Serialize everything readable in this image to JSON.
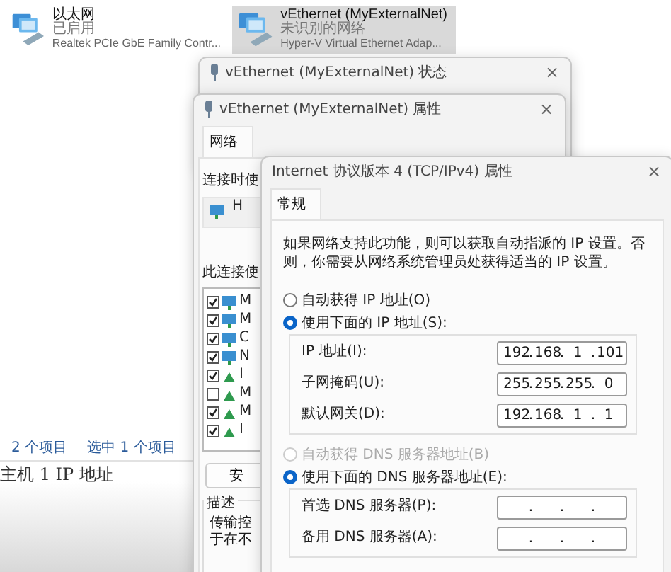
{
  "explorer": {
    "items": [
      {
        "name": "以太网",
        "status": "已启用",
        "device": "Realtek PCIe GbE Family Contr...",
        "selected": false
      },
      {
        "name": "vEthernet (MyExternalNet)",
        "status": "未识别的网络",
        "device": "Hyper-V Virtual Ethernet Adap...",
        "selected": true
      }
    ],
    "status_bar": [
      "2 个项目",
      "选中 1 个项目"
    ]
  },
  "page_heading": "主机 1 IP 地址",
  "status_window": {
    "title": "vEthernet (MyExternalNet) 状态",
    "close": "×"
  },
  "properties_window": {
    "title": "vEthernet (MyExternalNet) 属性",
    "close": "×",
    "tabs": [
      {
        "label": "网络",
        "selected": true
      }
    ],
    "connect_label": "连接时使",
    "adapter": "H",
    "items_label": "此连接使",
    "items": [
      {
        "kind": "client",
        "checked": true,
        "label": "M"
      },
      {
        "kind": "client",
        "checked": true,
        "label": "M"
      },
      {
        "kind": "client",
        "checked": true,
        "label": "C"
      },
      {
        "kind": "client",
        "checked": true,
        "label": "N"
      },
      {
        "kind": "protocol",
        "checked": true,
        "label": "I"
      },
      {
        "kind": "protocol",
        "checked": false,
        "label": "M"
      },
      {
        "kind": "protocol",
        "checked": true,
        "label": "M"
      },
      {
        "kind": "protocol",
        "checked": true,
        "label": "I"
      }
    ],
    "install_button": "安",
    "description_label": "描述",
    "description_lines": [
      "传输控",
      "于在不"
    ]
  },
  "ipv4_window": {
    "title": "Internet 协议版本 4 (TCP/IPv4) 属性",
    "close": "×",
    "tabs": [
      {
        "label": "常规",
        "selected": true
      }
    ],
    "intro": "如果网络支持此功能，则可以获取自动指派的 IP 设置。否则，你需要从网络系统管理员处获得适当的 IP 设置。",
    "separator": ".",
    "ip_radios": [
      {
        "label": "自动获得 IP 地址(O)",
        "selected": false,
        "disabled": false
      },
      {
        "label": "使用下面的 IP 地址(S):",
        "selected": true,
        "disabled": false
      }
    ],
    "ip_fields": [
      {
        "label": "IP 地址(I):",
        "octets": [
          "192",
          "168",
          "1",
          "101"
        ]
      },
      {
        "label": "子网掩码(U):",
        "octets": [
          "255",
          "255",
          "255",
          "0"
        ]
      },
      {
        "label": "默认网关(D):",
        "octets": [
          "192",
          "168",
          "1",
          "1"
        ]
      }
    ],
    "dns_radios": [
      {
        "label": "自动获得 DNS 服务器地址(B)",
        "selected": false,
        "disabled": true
      },
      {
        "label": "使用下面的 DNS 服务器地址(E):",
        "selected": true,
        "disabled": false
      }
    ],
    "dns_fields": [
      {
        "label": "首选 DNS 服务器(P):"
      },
      {
        "label": "备用 DNS 服务器(A):"
      }
    ]
  }
}
